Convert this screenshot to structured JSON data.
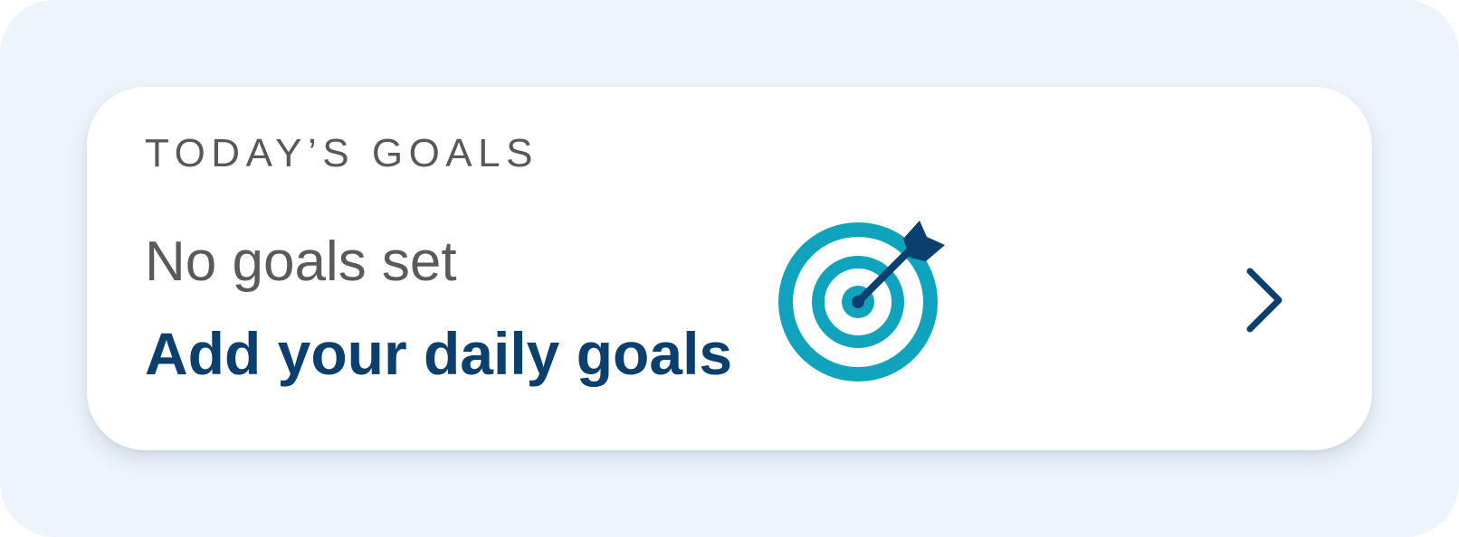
{
  "goals_card": {
    "section_title": "TODAY’S GOALS",
    "status_text": "No goals set",
    "cta_text": "Add your daily goals",
    "illustration_icon": "target-with-arrow-icon",
    "chevron_icon": "chevron-right-icon"
  },
  "colors": {
    "background": "#edf4fc",
    "card": "#ffffff",
    "title_text": "#585858",
    "cta_text": "#0a3f6e",
    "target_ring": "#0fa3bd",
    "arrow": "#0a3f6e"
  }
}
